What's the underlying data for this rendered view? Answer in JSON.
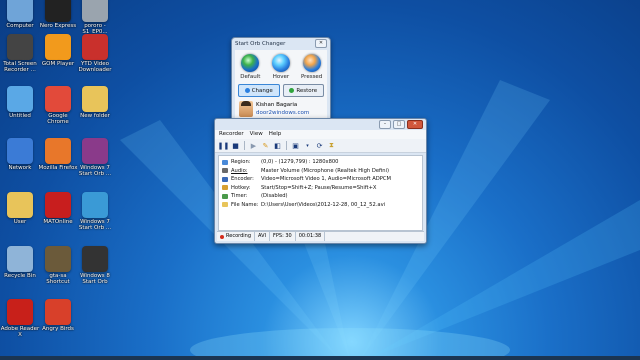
{
  "desktop": {
    "icons": [
      {
        "label": "Computer",
        "icon": "computer-icon",
        "color": "#6fa4d8"
      },
      {
        "label": "Nero Express",
        "icon": "nero-icon",
        "color": "#222222"
      },
      {
        "label": "pororo - S1_EP0...",
        "icon": "video-file-icon",
        "color": "#9aa4ae"
      },
      {
        "label": "Total Screen Recorder ...",
        "icon": "film-reel-icon",
        "color": "#444444"
      },
      {
        "label": "GOM Player",
        "icon": "gom-player-icon",
        "color": "#f29a1c"
      },
      {
        "label": "YTD Video Downloader",
        "icon": "ytd-icon",
        "color": "#c9302c"
      },
      {
        "label": "Untitled",
        "icon": "document-icon",
        "color": "#5aa8e6"
      },
      {
        "label": "Google Chrome",
        "icon": "chrome-icon",
        "color": "#e24a3a"
      },
      {
        "label": "New folder",
        "icon": "folder-icon",
        "color": "#e8c45a"
      },
      {
        "label": "Network",
        "icon": "network-icon",
        "color": "#3b7bd6"
      },
      {
        "label": "Mozilla Firefox",
        "icon": "firefox-icon",
        "color": "#e8772a"
      },
      {
        "label": "Windows 7 Start Orb ...",
        "icon": "winrar-icon",
        "color": "#8a3a8a"
      },
      {
        "label": "User",
        "icon": "user-folder-icon",
        "color": "#e8c45a"
      },
      {
        "label": "MATOnline",
        "icon": "mat-icon",
        "color": "#c81e1e"
      },
      {
        "label": "Windows 7 Start Orb ...",
        "icon": "windows-orb-icon",
        "color": "#3a9ad6"
      },
      {
        "label": "Recycle Bin",
        "icon": "recycle-bin-icon",
        "color": "#8fb4d8"
      },
      {
        "label": "gta-sa Shortcut",
        "icon": "gta-icon",
        "color": "#6b5a3a"
      },
      {
        "label": "Windows 8 Start Orb",
        "icon": "usb-icon",
        "color": "#333333"
      },
      {
        "label": "Adobe Reader X",
        "icon": "adobe-reader-icon",
        "color": "#c8201a"
      },
      {
        "label": "Angry Birds",
        "icon": "angry-birds-icon",
        "color": "#d8402a"
      }
    ]
  },
  "orb_window": {
    "title": "Start Orb Changer",
    "close": "✕",
    "orbs": [
      {
        "name": "Default"
      },
      {
        "name": "Hover"
      },
      {
        "name": "Pressed"
      }
    ],
    "change_label": "Change",
    "restore_label": "Restore",
    "author_name": "Kishan Bagaria",
    "author_link": "door2windows.com"
  },
  "recorder_window": {
    "min": "–",
    "max": "□",
    "close": "✕",
    "menu": [
      "Recorder",
      "View",
      "Help"
    ],
    "rows": [
      {
        "key": "Region:",
        "value": "(0,0) - (1279,799) : 1280x800",
        "icon_color": "#4a8ad8"
      },
      {
        "key": "Audio:",
        "value": "Master Volume (Microphone (Realtek High Defini)",
        "icon_color": "#6a6a6a"
      },
      {
        "key": "Encoder:",
        "value": "Video=Microsoft Video 1, Audio=Microsoft ADPCM",
        "icon_color": "#3a6ab8"
      },
      {
        "key": "Hotkey:",
        "value": "Start/Stop=Shift+Z; Pause/Resume=Shift+X",
        "icon_color": "#d8a030"
      },
      {
        "key": "Timer:",
        "value": "(Disabled)",
        "icon_color": "#4a9a4a"
      },
      {
        "key": "File Name:",
        "value": "D:\\Users\\User\\Videos\\2012-12-28, 00_12_52.avi",
        "icon_color": "#e8c45a"
      }
    ],
    "status": {
      "state": "Recording",
      "format": "AVI",
      "fps": "FPS: 30",
      "time": "00:01:38"
    }
  }
}
